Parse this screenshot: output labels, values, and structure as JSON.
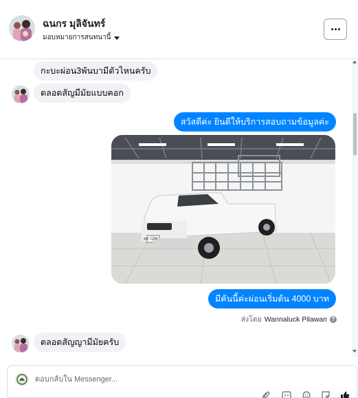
{
  "header": {
    "contact_name": "ฉนกร มุลิจันทร์",
    "assign_label": "มอบหมายการสนทนานี้",
    "more_icon": "more-horizontal-icon"
  },
  "thread": {
    "messages": [
      {
        "direction": "incoming",
        "text": "กะบะผ่อน3พันบามีตัวไหนครับ"
      },
      {
        "direction": "incoming",
        "text": "ตลอดสัญมีมัยแบบคอก"
      },
      {
        "direction": "outgoing",
        "text": "สวัสดีค่ะ  ยินดีให้บริการสอบถามข้อมูลค่ะ"
      },
      {
        "direction": "outgoing",
        "type": "photo",
        "subject": "white pickup truck with metal cage"
      },
      {
        "direction": "outgoing",
        "text": "มีคันนี้ค่ะผ่อนเริ่มต้น 4000 บาท"
      },
      {
        "direction": "incoming",
        "text": "ตลอดสัญญามีมัยครับ"
      }
    ],
    "sent_by_prefix": "ส่งโดย",
    "sent_by_name": "Wannaluck Pilawan",
    "plate_text": "ฒห 1234"
  },
  "composer": {
    "placeholder": "ตอบกลับใน Messenger...",
    "tools": [
      "attachment-icon",
      "gif-icon",
      "emoji-icon",
      "sticker-icon",
      "like-icon"
    ]
  },
  "colors": {
    "outgoing_bubble": "#0084ff",
    "incoming_bubble": "#f0f2f5",
    "text_primary": "#050505",
    "text_secondary": "#65676b"
  }
}
